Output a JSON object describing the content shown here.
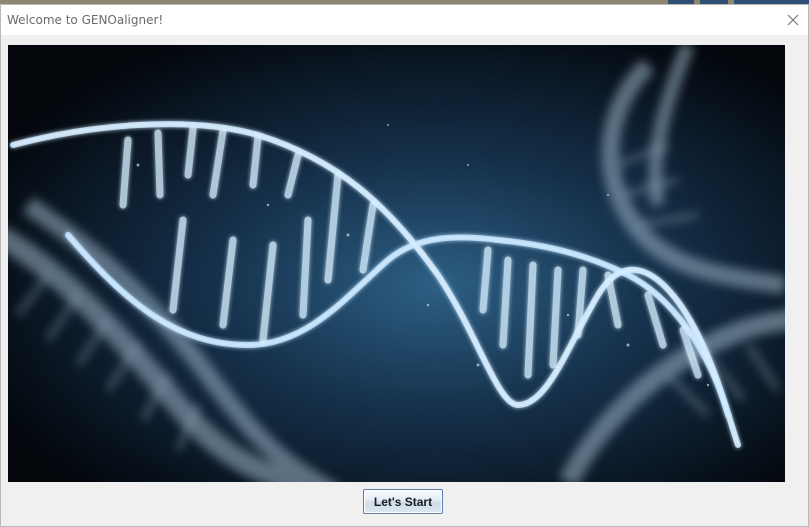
{
  "window": {
    "title": "Welcome to GENOaligner!",
    "close_icon": "close-icon"
  },
  "main": {
    "image_subject": "dna-double-helix",
    "start_button_label": "Let's Start"
  },
  "colors": {
    "titlebar": "#ffffff",
    "window_background": "#f0f0f0",
    "image_background": "#06090f",
    "helix_glow": "#bfe3ff",
    "button_border": "#5d7da6"
  }
}
